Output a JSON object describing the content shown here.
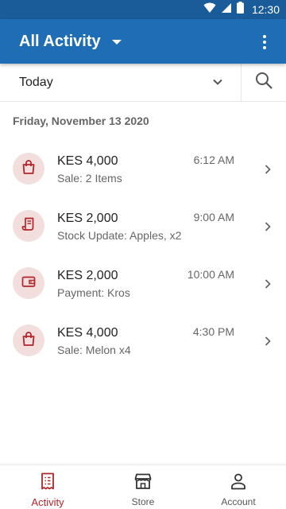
{
  "status_bar": {
    "time": "12:30"
  },
  "app_bar": {
    "title": "All Activity"
  },
  "filter": {
    "selected": "Today"
  },
  "date_header": "Friday, November 13 2020",
  "activities": [
    {
      "amount": "KES 4,000",
      "description": "Sale: 2 Items",
      "time": "6:12 AM",
      "icon": "shopping-bag-icon"
    },
    {
      "amount": "KES 2,000",
      "description": "Stock Update: Apples, x2",
      "time": "9:00 AM",
      "icon": "receipt-scroll-icon"
    },
    {
      "amount": "KES 2,000",
      "description": "Payment: Kros",
      "time": "10:00 AM",
      "icon": "wallet-icon"
    },
    {
      "amount": "KES 4,000",
      "description": "Sale: Melon x4",
      "time": "4:30 PM",
      "icon": "shopping-bag-icon"
    }
  ],
  "bottom_nav": [
    {
      "label": "Activity",
      "icon": "activity-receipt-icon",
      "active": true
    },
    {
      "label": "Store",
      "icon": "store-icon",
      "active": false
    },
    {
      "label": "Account",
      "icon": "account-person-icon",
      "active": false
    }
  ],
  "colors": {
    "status_bar": "#1a5c9a",
    "app_bar": "#1f6db4",
    "accent": "#b3262b",
    "avatar_bg": "#f3dede"
  }
}
